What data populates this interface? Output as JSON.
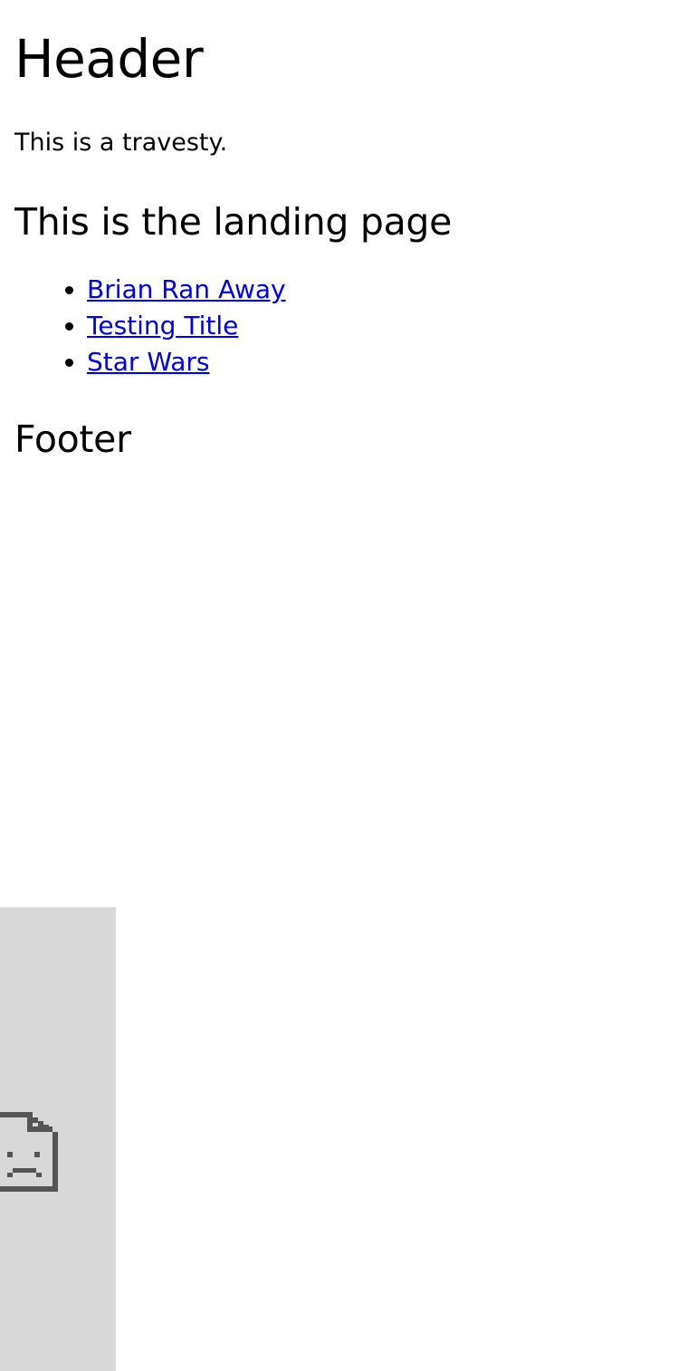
{
  "header": {
    "title": "Header",
    "tagline": "This is a travesty."
  },
  "main": {
    "title": "This is the landing page",
    "links": [
      {
        "label": "Brian Ran Away"
      },
      {
        "label": "Testing Title"
      },
      {
        "label": "Star Wars"
      }
    ]
  },
  "footer": {
    "title": "Footer"
  },
  "broken_image": {
    "icon": "broken-image-icon",
    "background": "#d8d8d8",
    "icon_color": "#555555"
  },
  "colors": {
    "text": "#000000",
    "link": "#0000ee",
    "background": "#ffffff"
  }
}
